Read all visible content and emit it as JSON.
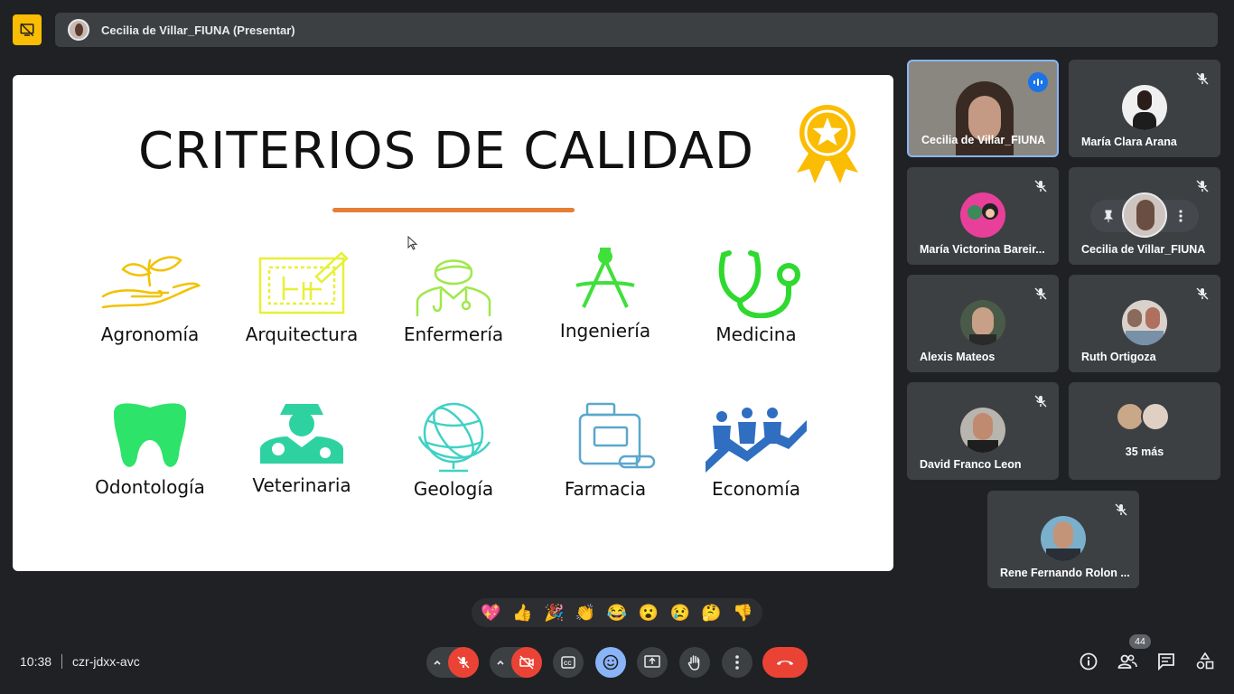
{
  "meeting": {
    "presenter_label": "Cecilia de Villar_FIUNA (Presentar)",
    "time": "10:38",
    "code": "czr-jdxx-avc",
    "participant_count": "44"
  },
  "slide": {
    "title": "CRITERIOS DE CALIDAD",
    "items": [
      {
        "label": "Agronomía",
        "icon": "plant-hand-icon",
        "color": "#f2c200"
      },
      {
        "label": "Arquitectura",
        "icon": "blueprint-icon",
        "color": "#e8f035"
      },
      {
        "label": "Enfermería",
        "icon": "nurse-icon",
        "color": "#9fe84a"
      },
      {
        "label": "Ingeniería",
        "icon": "compass-icon",
        "color": "#3fe03a"
      },
      {
        "label": "Medicina",
        "icon": "stethoscope-icon",
        "color": "#2fd92f"
      },
      {
        "label": "Odontología",
        "icon": "tooth-icon",
        "color": "#2de36a"
      },
      {
        "label": "Veterinaria",
        "icon": "veterinarian-icon",
        "color": "#2ed2a0"
      },
      {
        "label": "Geología",
        "icon": "globe-icon",
        "color": "#3fd2c4"
      },
      {
        "label": "Farmacia",
        "icon": "medicine-bottle-icon",
        "color": "#5ba7cc"
      },
      {
        "label": "Economía",
        "icon": "people-growth-icon",
        "color": "#2f6ec0"
      }
    ]
  },
  "participants": [
    {
      "name": "Cecilia de Villar_FIUNA",
      "state": "speaking"
    },
    {
      "name": "María Clara Arana",
      "state": "muted"
    },
    {
      "name": "María Victorina Bareir...",
      "state": "muted"
    },
    {
      "name": "Cecilia de Villar_FIUNA",
      "state": "muted"
    },
    {
      "name": "Alexis Mateos",
      "state": "muted"
    },
    {
      "name": "Ruth Ortigoza",
      "state": "muted"
    },
    {
      "name": "David Franco Leon",
      "state": "muted"
    },
    {
      "name": "35 más",
      "state": "group"
    },
    {
      "name": "Rene Fernando Rolon ...",
      "state": "muted"
    }
  ],
  "reactions": [
    "💖",
    "👍",
    "🎉",
    "👏",
    "😂",
    "😮",
    "😢",
    "🤔",
    "👎"
  ],
  "colors": {
    "accent_red": "#ea4335",
    "accent_blue": "#8ab4f8",
    "presenting_yellow": "#fbbc04",
    "title_underline": "#e67e35"
  }
}
